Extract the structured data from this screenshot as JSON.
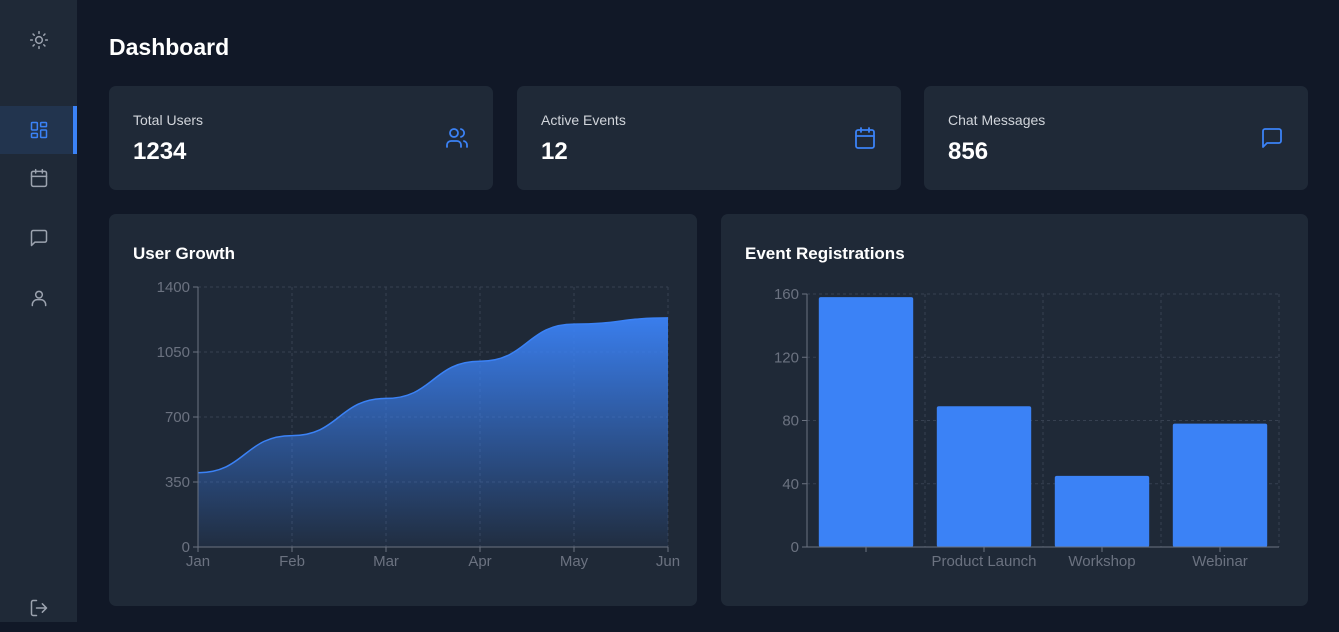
{
  "sidebar": {
    "icons": [
      "sun-icon",
      "dashboard-icon",
      "calendar-icon",
      "chat-icon",
      "user-icon",
      "logout-icon"
    ],
    "active": "dashboard-icon"
  },
  "header": {
    "title": "Dashboard"
  },
  "stats": [
    {
      "label": "Total Users",
      "value": "1234",
      "icon": "users-icon"
    },
    {
      "label": "Active Events",
      "value": "12",
      "icon": "calendar-icon"
    },
    {
      "label": "Chat Messages",
      "value": "856",
      "icon": "chat-icon"
    }
  ],
  "colors": {
    "accent": "#3b82f6",
    "background": "#111827",
    "card": "#1f2937"
  },
  "chart_data": [
    {
      "type": "area",
      "title": "User Growth",
      "x": [
        "Jan",
        "Feb",
        "Mar",
        "Apr",
        "May",
        "Jun"
      ],
      "y": [
        400,
        600,
        800,
        1000,
        1200,
        1234
      ],
      "ylim": [
        0,
        1400
      ],
      "yticks": [
        0,
        350,
        700,
        1050,
        1400
      ],
      "grid": true
    },
    {
      "type": "bar",
      "title": "Event Registrations",
      "categories": [
        "",
        "Product Launch",
        "Workshop",
        "Webinar"
      ],
      "values": [
        158,
        89,
        45,
        78
      ],
      "ylim": [
        0,
        160
      ],
      "yticks": [
        0,
        40,
        80,
        120,
        160
      ],
      "grid": true
    }
  ]
}
